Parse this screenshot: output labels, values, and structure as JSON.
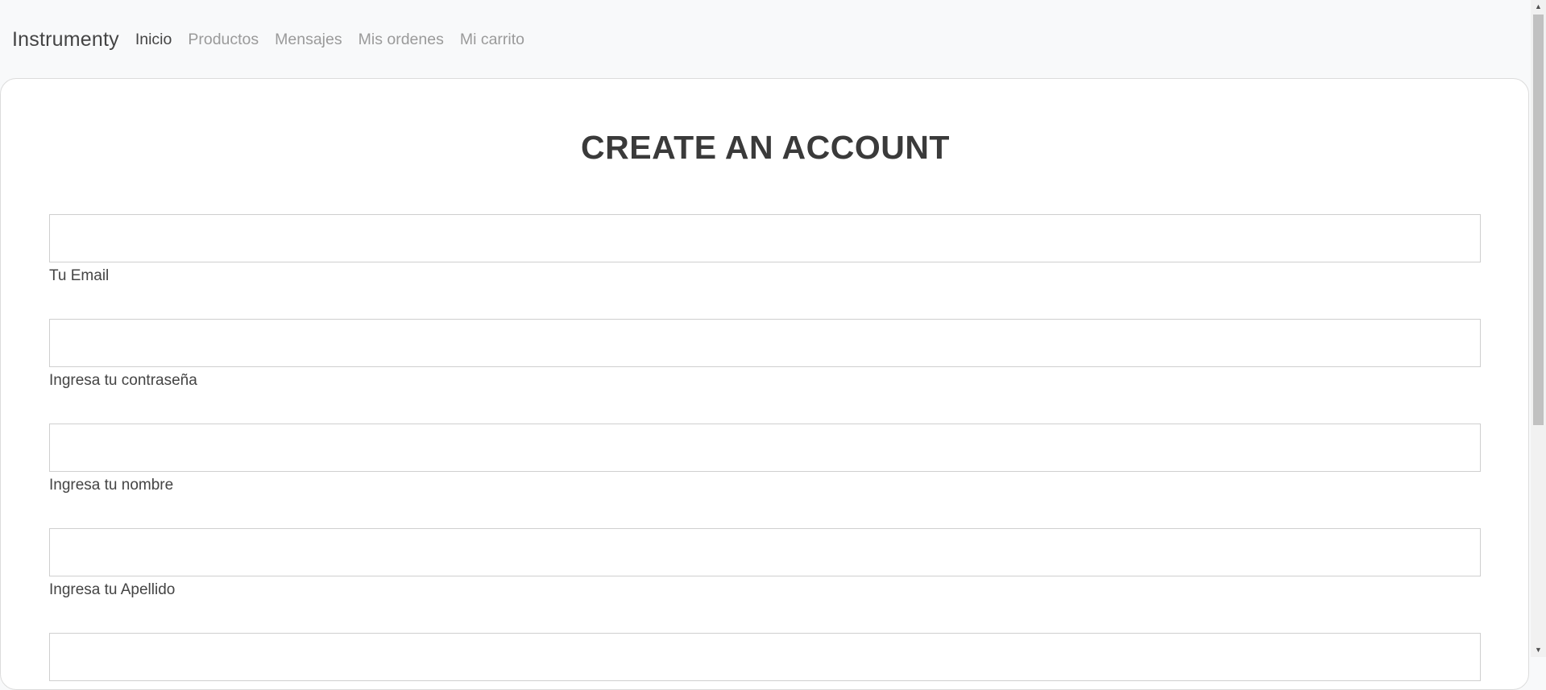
{
  "navbar": {
    "brand": "Instrumenty",
    "links": [
      {
        "label": "Inicio",
        "active": true
      },
      {
        "label": "Productos",
        "active": false
      },
      {
        "label": "Mensajes",
        "active": false
      },
      {
        "label": "Mis ordenes",
        "active": false
      },
      {
        "label": "Mi carrito",
        "active": false
      }
    ]
  },
  "form": {
    "title": "CREATE AN ACCOUNT",
    "fields": [
      {
        "label": "Tu Email",
        "value": ""
      },
      {
        "label": "Ingresa tu contraseña",
        "value": ""
      },
      {
        "label": "Ingresa tu nombre",
        "value": ""
      },
      {
        "label": "Ingresa tu Apellido",
        "value": ""
      },
      {
        "label": "",
        "value": ""
      }
    ]
  },
  "scrollbar": {
    "up_icon": "triangle-up-icon",
    "down_icon": "triangle-down-icon"
  }
}
